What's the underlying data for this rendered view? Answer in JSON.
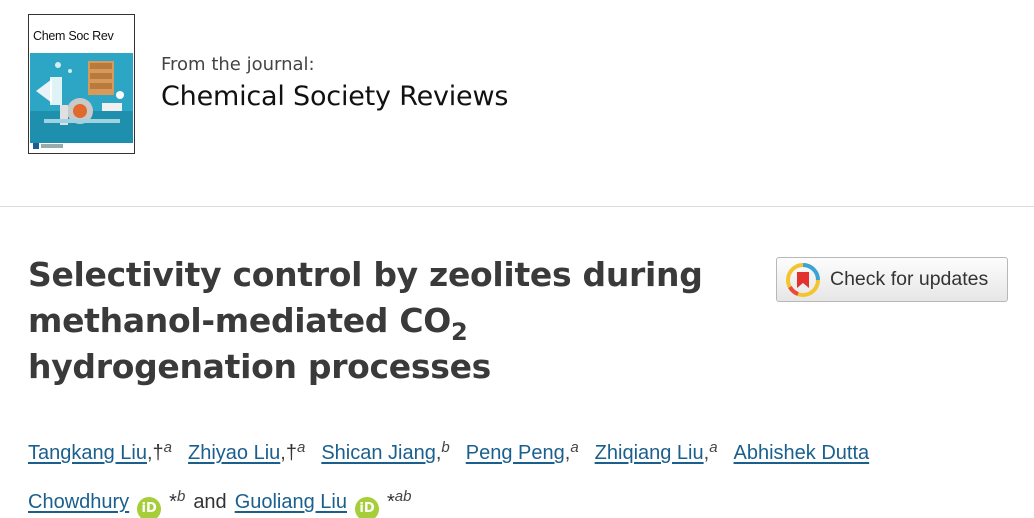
{
  "journal": {
    "cover_title": "Chem Soc Rev",
    "from_label": "From the journal:",
    "name": "Chemical Society Reviews"
  },
  "article": {
    "title_line1": "Selectivity control by zeolites during",
    "title_line2_pre": "methanol-mediated CO",
    "title_line2_sub": "2",
    "title_line3": "hydrogenation processes"
  },
  "check_updates": {
    "label": "Check for updates",
    "icon": "crossmark-icon"
  },
  "authors": {
    "a1": {
      "name": "Tangkang Liu",
      "marks": "†",
      "aff": "a"
    },
    "a2": {
      "name": "Zhiyao Liu",
      "marks": "†",
      "aff": "a"
    },
    "a3": {
      "name": "Shican Jiang",
      "aff": "b"
    },
    "a4": {
      "name": "Peng Peng",
      "aff": "a"
    },
    "a5": {
      "name": "Zhiqiang Liu",
      "aff": "a"
    },
    "a6": {
      "name_line1": "Abhishek Dutta",
      "name_line2": "Chowdhury",
      "star": "*",
      "aff": "b"
    },
    "a7": {
      "name": "Guoliang Liu",
      "star": "*",
      "aff": "ab"
    },
    "and_word": "and",
    "orcid_glyph": "iD",
    "comma": ","
  },
  "colors": {
    "link": "#1a5f8e",
    "orcid": "#a6ce39",
    "title": "#3a3a3a"
  }
}
